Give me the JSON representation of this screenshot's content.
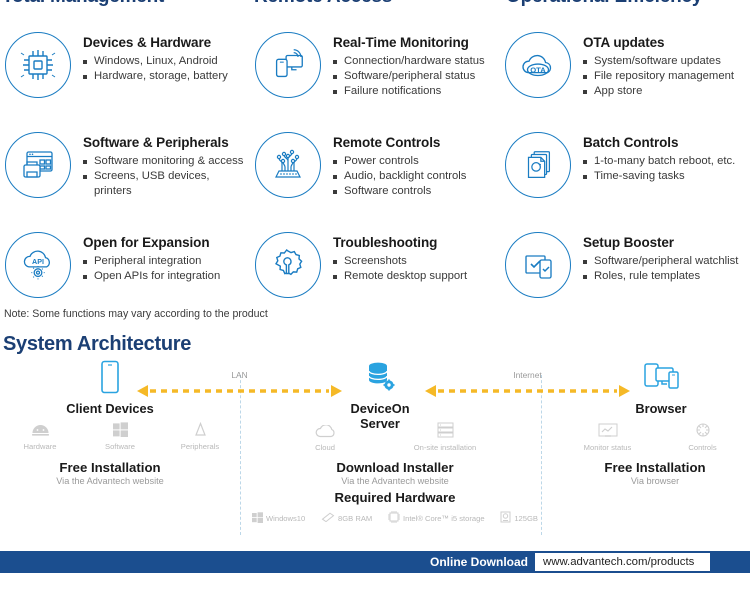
{
  "columns": [
    {
      "heading": "Total Management"
    },
    {
      "heading": "Remote Access"
    },
    {
      "heading": "Operational Efficiency"
    }
  ],
  "features": [
    {
      "icon": "chip-icon",
      "title": "Devices & Hardware",
      "bullets": [
        "Windows, Linux, Android",
        "Hardware, storage, battery"
      ]
    },
    {
      "icon": "realtime-monitor-icon",
      "title": "Real-Time Monitoring",
      "bullets": [
        "Connection/hardware status",
        "Software/peripheral status",
        "Failure notifications"
      ]
    },
    {
      "icon": "ota-cloud-icon",
      "title": "OTA updates",
      "bullets": [
        "System/software updates",
        "File repository management",
        "App store"
      ]
    },
    {
      "icon": "software-peripherals-icon",
      "title": "Software & Peripherals",
      "bullets": [
        "Software monitoring & access",
        "Screens, USB devices, printers"
      ]
    },
    {
      "icon": "circuit-controls-icon",
      "title": "Remote Controls",
      "bullets": [
        "Power controls",
        "Audio, backlight controls",
        "Software controls"
      ]
    },
    {
      "icon": "batch-stack-icon",
      "title": "Batch Controls",
      "bullets": [
        "1-to-many batch reboot, etc.",
        "Time-saving tasks"
      ]
    },
    {
      "icon": "api-cloud-gear-icon",
      "title": "Open for Expansion",
      "bullets": [
        "Peripheral integration",
        "Open APIs for integration"
      ]
    },
    {
      "icon": "gear-wrench-icon",
      "title": "Troubleshooting",
      "bullets": [
        "Screenshots",
        "Remote desktop support"
      ]
    },
    {
      "icon": "setup-checklist-icon",
      "title": "Setup Booster",
      "bullets": [
        "Software/peripheral watchlist",
        "Roles, rule templates"
      ]
    }
  ],
  "note": "Note: Some functions may vary according to the product",
  "architecture": {
    "title": "System Architecture",
    "client": {
      "icon": "tablet-device-icon",
      "label": "Client Devices",
      "sub_icons": [
        {
          "icon": "android-icon",
          "label": "Hardware"
        },
        {
          "icon": "windows-icon",
          "label": "Software"
        },
        {
          "icon": "peripherals-icon",
          "label": "Peripherals"
        }
      ],
      "install_title": "Free Installation",
      "install_sub": "Via the Advantech website"
    },
    "server": {
      "icon": "database-gear-icon",
      "label": "DeviceOn Server",
      "sub_icons": [
        {
          "icon": "cloud-icon",
          "label": "Cloud"
        },
        {
          "icon": "server-rack-icon",
          "label": "On-site installation"
        }
      ],
      "install_title": "Download Installer",
      "install_sub": "Via the Advantech website",
      "required_hardware_title": "Required Hardware",
      "required_hardware": [
        {
          "icon": "windows-icon",
          "label": "Windows10"
        },
        {
          "icon": "ram-icon",
          "label": "8GB RAM"
        },
        {
          "icon": "cpu-icon",
          "label": "Intel® Core™ i5 storage"
        },
        {
          "icon": "hdd-icon",
          "label": "125GB"
        }
      ]
    },
    "browser": {
      "icon": "multi-device-icon",
      "label": "Browser",
      "sub_icons": [
        {
          "icon": "monitor-status-icon",
          "label": "Monitor status"
        },
        {
          "icon": "controls-gear-icon",
          "label": "Controls"
        }
      ],
      "install_title": "Free Installation",
      "install_sub": "Via browser"
    },
    "links": [
      {
        "label": "LAN"
      },
      {
        "label": "Internet"
      }
    ]
  },
  "footer": {
    "label": "Online Download",
    "url": "www.advantech.com/products"
  },
  "colors": {
    "brand_blue": "#1a7cc2",
    "heading_navy": "#1b3f74",
    "footer_bar": "#1b4e8f",
    "arrow_yellow": "#f5b927"
  }
}
